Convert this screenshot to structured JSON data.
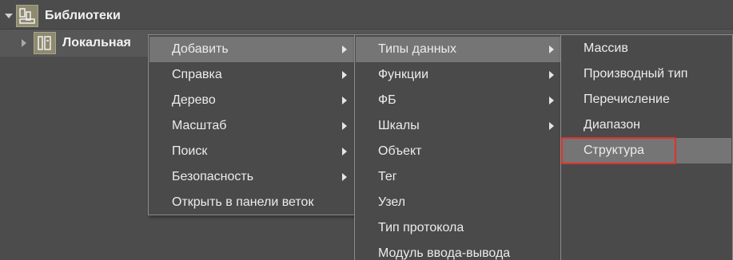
{
  "tree": {
    "root": {
      "label": "Библиотеки",
      "icon": "library-icon",
      "expanded": true
    },
    "child": {
      "label": "Локальная",
      "icon": "local-library-icon",
      "expanded": false
    }
  },
  "menu_main": {
    "items": [
      {
        "label": "Добавить",
        "submenu": true,
        "highlighted": true
      },
      {
        "label": "Справка",
        "submenu": true
      },
      {
        "label": "Дерево",
        "submenu": true
      },
      {
        "label": "Масштаб",
        "submenu": true
      },
      {
        "label": "Поиск",
        "submenu": true
      },
      {
        "label": "Безопасность",
        "submenu": true
      },
      {
        "label": "Открыть в панели веток",
        "submenu": false
      }
    ]
  },
  "menu_add": {
    "items": [
      {
        "label": "Типы данных",
        "submenu": true,
        "highlighted": true
      },
      {
        "label": "Функции",
        "submenu": true
      },
      {
        "label": "ФБ",
        "submenu": true
      },
      {
        "label": "Шкалы",
        "submenu": true
      },
      {
        "label": "Объект",
        "submenu": false
      },
      {
        "label": "Тег",
        "submenu": false
      },
      {
        "label": "Узел",
        "submenu": false
      },
      {
        "label": "Тип протокола",
        "submenu": false
      },
      {
        "label": "Модуль ввода-вывода",
        "submenu": false
      }
    ]
  },
  "menu_datatypes": {
    "items": [
      {
        "label": "Массив"
      },
      {
        "label": "Производный тип"
      },
      {
        "label": "Перечисление"
      },
      {
        "label": "Диапазон"
      },
      {
        "label": "Структура",
        "highlighted": true,
        "annotated": true
      }
    ]
  },
  "colors": {
    "background": "#4c4c4c",
    "menu_background": "#4a4a4a",
    "highlight": "#757575",
    "annotation": "#e0312b",
    "icon_background": "#8e8a6f"
  }
}
